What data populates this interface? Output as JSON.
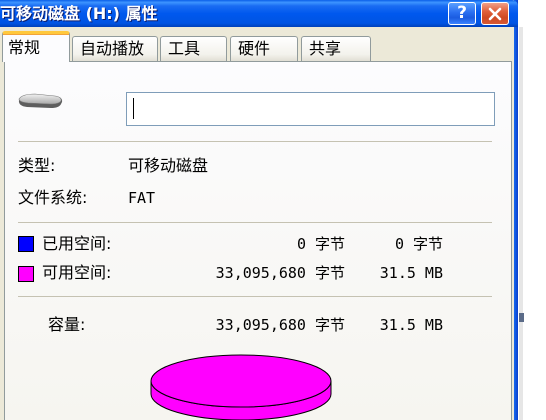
{
  "window": {
    "title": "可移动磁盘 (H:) 属性",
    "help_label": "?",
    "help_icon": "help-icon",
    "close_icon": "close-icon"
  },
  "tabs": [
    {
      "label": "常规",
      "selected": true
    },
    {
      "label": "自动播放",
      "selected": false
    },
    {
      "label": "工具",
      "selected": false
    },
    {
      "label": "硬件",
      "selected": false
    },
    {
      "label": "共享",
      "selected": false
    }
  ],
  "general": {
    "drive_icon": "removable-drive-icon",
    "volume_label": "",
    "type_label": "类型:",
    "type_value": "可移动磁盘",
    "fs_label": "文件系统:",
    "fs_value": "FAT",
    "used": {
      "label": "已用空间:",
      "bytes_text": "0 字节",
      "size_text": "0 字节",
      "color": "#0000FF"
    },
    "free": {
      "label": "可用空间:",
      "bytes_text": "33,095,680 字节",
      "size_text": "31.5 MB",
      "color": "#FF00FF"
    },
    "capacity": {
      "label": "容量:",
      "bytes_text": "33,095,680 字节",
      "size_text": "31.5 MB"
    }
  },
  "usage_pie": {
    "used_bytes": 0,
    "free_bytes": 33095680
  }
}
